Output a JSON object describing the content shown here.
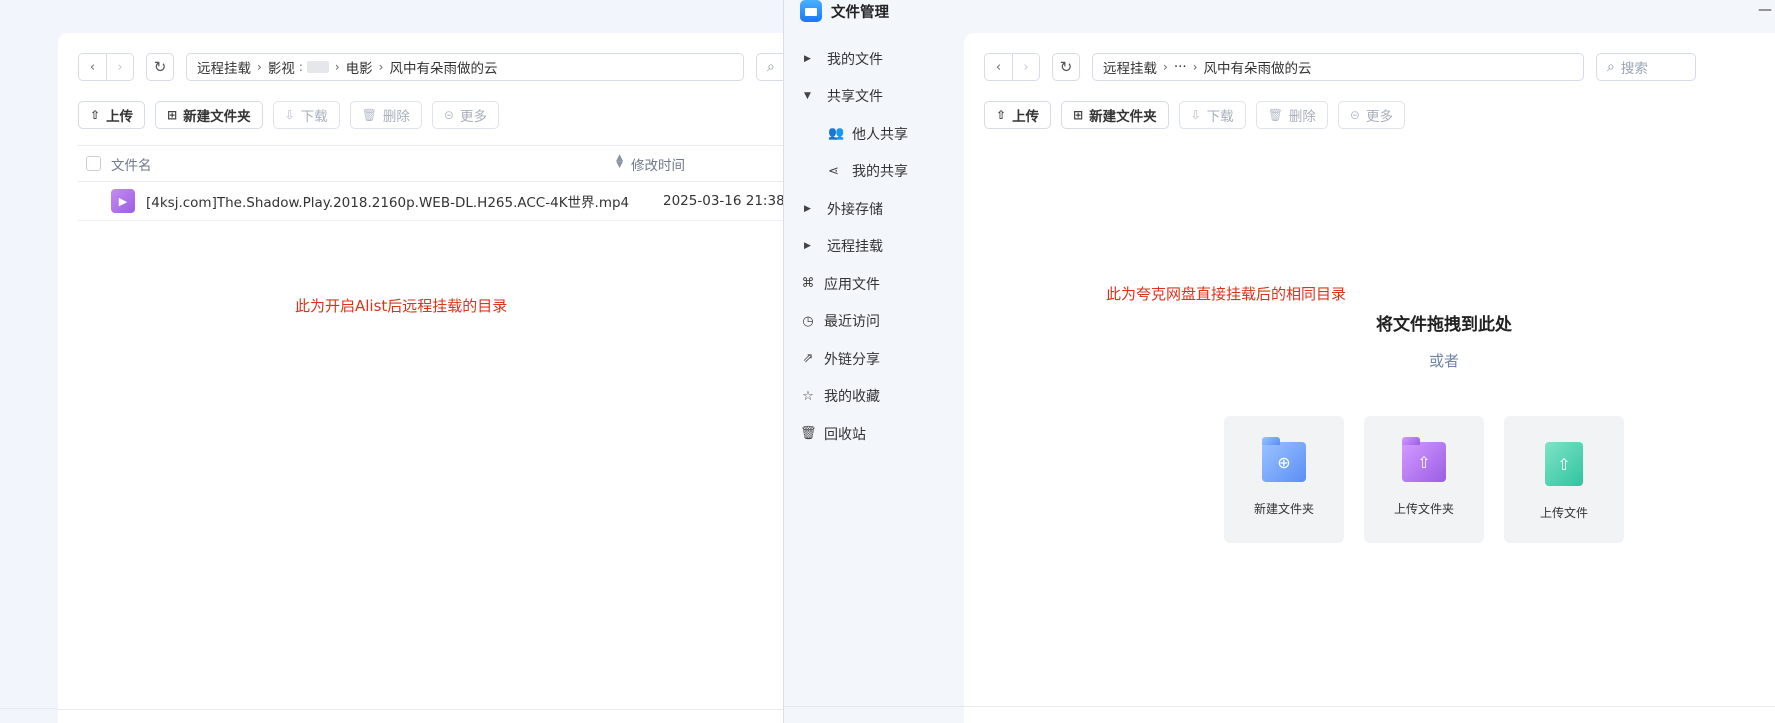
{
  "left": {
    "path": {
      "root": "远程挂载",
      "seg1": "影视",
      "seg3": "电影",
      "seg4": "风中有朵雨做的云"
    },
    "actions": {
      "upload": "上传",
      "new_folder": "新建文件夹",
      "download": "下载",
      "delete": "删除",
      "more": "更多"
    },
    "columns": {
      "name": "文件名",
      "modified": "修改时间"
    },
    "file": {
      "name": "[4ksj.com]The.Shadow.Play.2018.2160p.WEB-DL.H265.ACC-4K世界.mp4",
      "modified": "2025-03-16 21:38"
    },
    "annotation": "此为开启Alist后远程挂载的目录"
  },
  "right": {
    "app_title": "文件管理",
    "minimize": "—",
    "sidebar": [
      {
        "label": "我的文件"
      },
      {
        "label": "共享文件"
      },
      {
        "label": "他人共享"
      },
      {
        "label": "我的共享"
      },
      {
        "label": "外接存储"
      },
      {
        "label": "远程挂载"
      },
      {
        "label": "应用文件"
      },
      {
        "label": "最近访问"
      },
      {
        "label": "外链分享"
      },
      {
        "label": "我的收藏"
      },
      {
        "label": "回收站"
      }
    ],
    "path": {
      "root": "远程挂载",
      "ellipsis": "···",
      "current": "风中有朵雨做的云"
    },
    "search_placeholder": "搜索",
    "actions": {
      "upload": "上传",
      "new_folder": "新建文件夹",
      "download": "下载",
      "delete": "删除",
      "more": "更多"
    },
    "annotation": "此为夸克网盘直接挂载后的相同目录",
    "drop_title": "将文件拖拽到此处",
    "drop_or": "或者",
    "cards": [
      {
        "label": "新建文件夹",
        "icon": "new-folder-icon",
        "color": "#5b8ef5"
      },
      {
        "label": "上传文件夹",
        "icon": "upload-folder-icon",
        "color": "#9b5de5"
      },
      {
        "label": "上传文件",
        "icon": "upload-file-icon",
        "color": "#2ec4a0"
      }
    ]
  },
  "colors": {
    "annotation": "#e0321b",
    "background": "#f2f5fb",
    "panel": "#ffffff"
  }
}
